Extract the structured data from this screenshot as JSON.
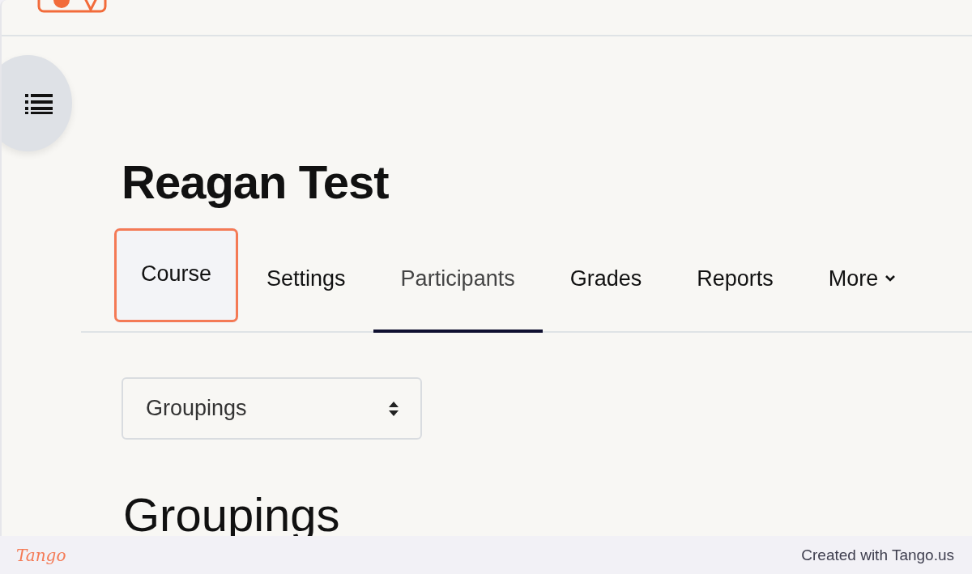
{
  "page_title": "Reagan Test",
  "tabs": [
    {
      "label": "Course",
      "selected": false,
      "highlighted": true
    },
    {
      "label": "Settings",
      "selected": false,
      "highlighted": false
    },
    {
      "label": "Participants",
      "selected": true,
      "highlighted": false
    },
    {
      "label": "Grades",
      "selected": false,
      "highlighted": false
    },
    {
      "label": "Reports",
      "selected": false,
      "highlighted": false
    },
    {
      "label": "More",
      "selected": false,
      "highlighted": false,
      "kind": "menu"
    }
  ],
  "select": {
    "value": "Groupings"
  },
  "section_heading": "Groupings",
  "footer": {
    "logo": "Tango",
    "credit": "Created with Tango.us"
  }
}
